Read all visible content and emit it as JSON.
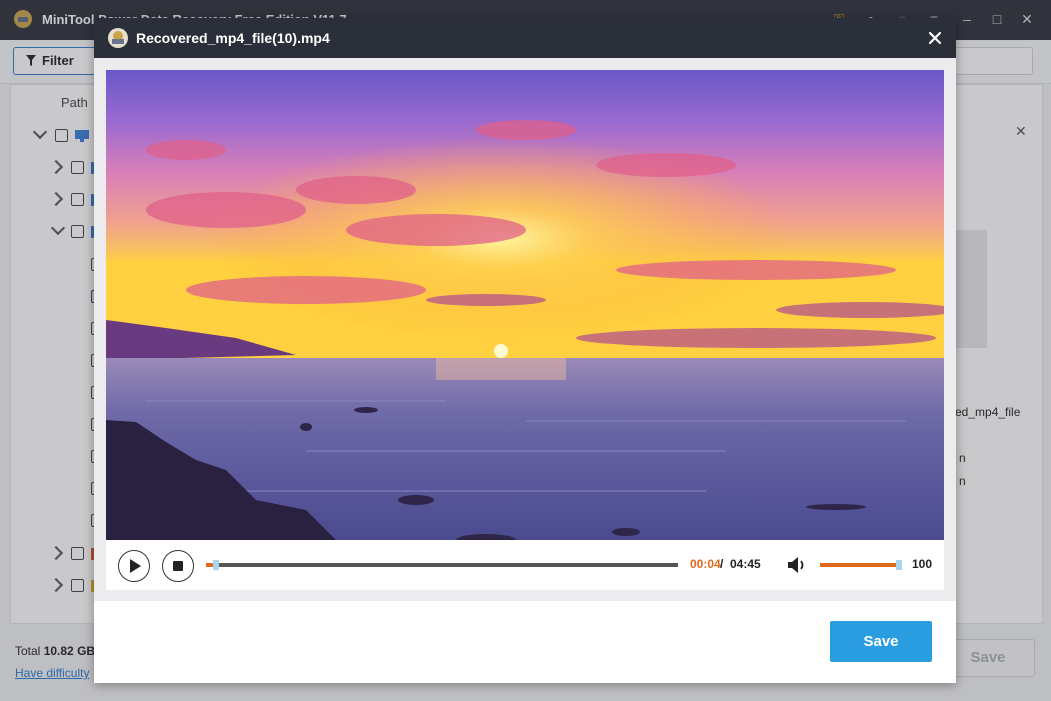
{
  "app": {
    "title": "MiniTool Power Data Recovery Free Edition V11.7",
    "filter_label": "Filter",
    "path_header": "Path",
    "side_fragment": "ed_mp4_file",
    "side_frag_2": "n",
    "side_frag_3": "n",
    "total_prefix": "Total",
    "total_value": "10.82 GB",
    "help_link": "Have difficulty",
    "save_label": "Save"
  },
  "dialog": {
    "title": "Recovered_mp4_file(10).mp4",
    "save_label": "Save"
  },
  "player": {
    "current_time": "00:04",
    "separator": "/",
    "total_time": "04:45",
    "progress_fraction": 0.014,
    "volume": "100",
    "volume_fraction": 1.0
  },
  "colors": {
    "accent": "#e06a1d",
    "save_button": "#2a9de0",
    "titlebar": "#2b2f3a"
  },
  "icons": {
    "play": "play-icon",
    "stop": "stop-icon",
    "volume": "speaker-icon",
    "close": "close-icon",
    "logo": "minitool-logo-icon"
  }
}
